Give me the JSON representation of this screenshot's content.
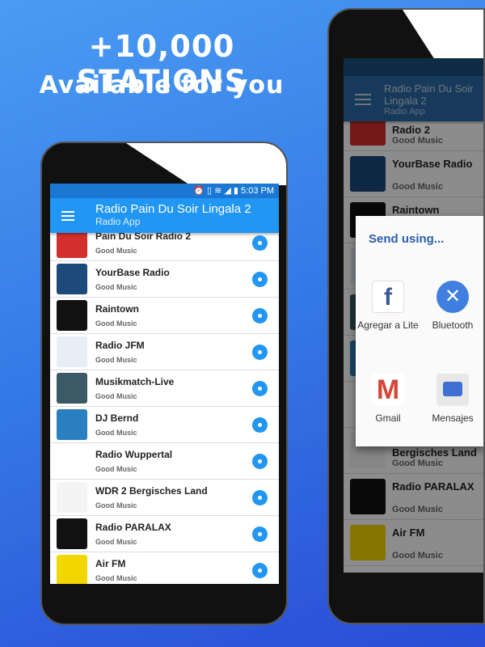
{
  "promo": {
    "headline": "+10,000 STATIONS",
    "subheadline": "Available for you"
  },
  "app": {
    "status_time": "5:03 PM",
    "title": "Radio Pain Du Soir Lingala 2",
    "subtitle": "Radio App",
    "accent": "#2196f3"
  },
  "stations": [
    {
      "name": "Pain Du Soir Radio 2",
      "sub": "Good Music",
      "color": "#d32f2f"
    },
    {
      "name": "YourBase Radio",
      "sub": "Good Music",
      "color": "#1c4a7a"
    },
    {
      "name": "Raintown",
      "sub": "Good Music",
      "color": "#111111"
    },
    {
      "name": "Radio JFM",
      "sub": "Good Music",
      "color": "#e8eef8"
    },
    {
      "name": "Musikmatch-Live",
      "sub": "Good Music",
      "color": "#3b5a66"
    },
    {
      "name": "DJ Bernd",
      "sub": "Good Music",
      "color": "#2a7fc0"
    },
    {
      "name": "Radio Wuppertal",
      "sub": "Good Music",
      "color": "#ffffff"
    },
    {
      "name": "WDR 2 Bergisches Land",
      "sub": "Good Music",
      "color": "#f4f4f4"
    },
    {
      "name": "Radio PARALAX",
      "sub": "Good Music",
      "color": "#111111"
    },
    {
      "name": "Air FM",
      "sub": "Good Music",
      "color": "#f2d600"
    }
  ],
  "right_phone": {
    "title": "Radio Pain Du Soir Lingala 2",
    "subtitle": "Radio App",
    "dialog": {
      "title": "Send using...",
      "apps": [
        "Agregar a Lite",
        "Bluetooth",
        "Gmail",
        "Mensajes"
      ]
    }
  }
}
